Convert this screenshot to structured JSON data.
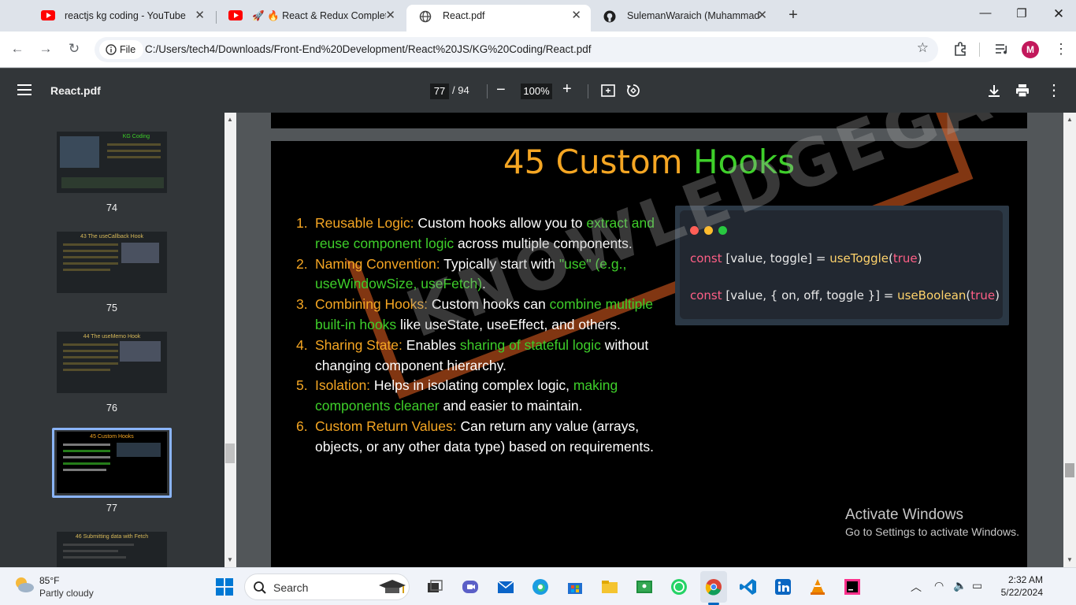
{
  "browser": {
    "tabs": [
      {
        "title": "reactjs kg coding - YouTube",
        "icon": "youtube-icon"
      },
      {
        "title": "🚀 🔥 React & Redux Complete",
        "icon": "youtube-icon"
      },
      {
        "title": "React.pdf",
        "icon": "globe-icon",
        "active": true
      },
      {
        "title": "SulemanWaraich (Muhammad S",
        "icon": "github-icon"
      }
    ],
    "site_chip": "File",
    "url": "C:/Users/tech4/Downloads/Front-End%20Development/React%20JS/KG%20Coding/React.pdf",
    "profile_initial": "M"
  },
  "pdf_toolbar": {
    "title": "React.pdf",
    "current_page": "77",
    "total_pages": "/ 94",
    "zoom": "100%"
  },
  "thumbnails": [
    {
      "page": "74",
      "title": "KG Coding"
    },
    {
      "page": "75",
      "title": "43 The useCallback Hook"
    },
    {
      "page": "76",
      "title": "44 The useMemo Hook"
    },
    {
      "page": "77",
      "title": "45 Custom Hooks",
      "selected": true
    },
    {
      "page": "78",
      "title": "46 Submitting data with Fetch"
    }
  ],
  "slide": {
    "title_num": "45 Custom",
    "title_word": "Hooks",
    "items": [
      {
        "n": "1.",
        "head": "Reusable Logic:",
        "t1": " Custom hooks allow you to ",
        "g1": "extract and reuse component logic",
        "t2": " across multiple components.",
        "g2": "",
        "t3": ""
      },
      {
        "n": "2.",
        "head": "Naming Convention:",
        "t1": " Typically start with ",
        "g1": "\"use\" (e.g., useWindowSize, useFetch)",
        "t2": ".",
        "g2": "",
        "t3": ""
      },
      {
        "n": "3.",
        "head": "Combining Hooks:",
        "t1": " Custom hooks can ",
        "g1": "combine multiple built-in hooks",
        "t2": " like useState, useEffect, and others.",
        "g2": "",
        "t3": ""
      },
      {
        "n": "4.",
        "head": "Sharing State:",
        "t1": " Enables ",
        "g1": "sharing of stateful logic",
        "t2": " without changing component hierarchy.",
        "g2": "",
        "t3": ""
      },
      {
        "n": "5.",
        "head": "Isolation:",
        "t1": " Helps in isolating complex logic, ",
        "g1": "making components cleaner",
        "t2": " and easier to maintain.",
        "g2": "",
        "t3": ""
      },
      {
        "n": "6.",
        "head": "Custom Return Values:",
        "t1": " Can return any value (arrays, objects, or any other data type) based on requirements.",
        "g1": "",
        "t2": "",
        "g2": "",
        "t3": ""
      }
    ],
    "code": {
      "line1": {
        "kw": "const",
        "vars": " [value, toggle] = ",
        "fn": "useToggle",
        "open": "(",
        "arg": "true",
        "close": ")"
      },
      "line2": {
        "kw": "const",
        "vars": " [value, { on, off, toggle }] = ",
        "fn": "useBoolean",
        "open": "(",
        "arg": "true",
        "close": ")"
      }
    },
    "watermark": "KNOWLEDGEGATE"
  },
  "activation": {
    "line1": "Activate Windows",
    "line2": "Go to Settings to activate Windows."
  },
  "taskbar": {
    "temperature": "85°F",
    "weather": "Partly cloudy",
    "search_label": "Search",
    "time": "2:32 AM",
    "date": "5/22/2024"
  }
}
